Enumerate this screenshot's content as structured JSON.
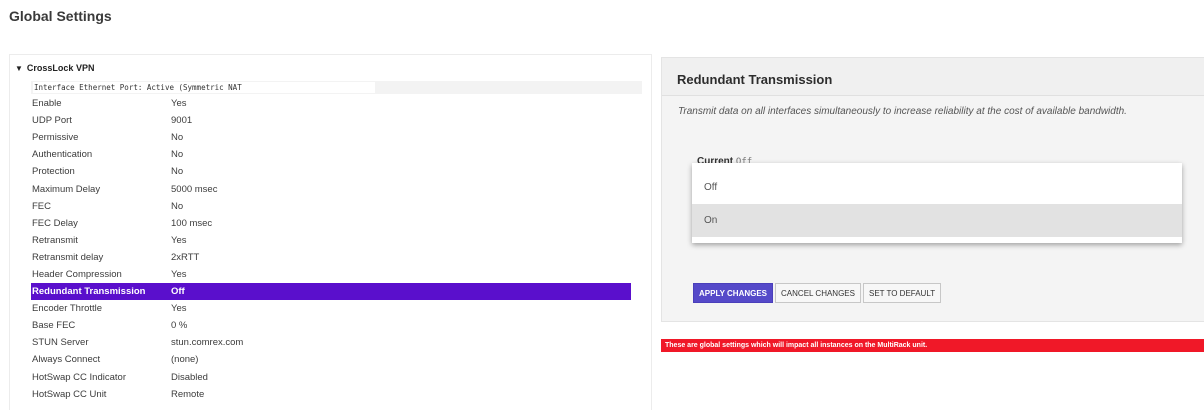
{
  "page": {
    "title": "Global Settings"
  },
  "tree": {
    "group_label": "CrossLock VPN",
    "interface_text": "Interface Ethernet Port: Active (Symmetric NAT",
    "rows": [
      {
        "label": "Enable",
        "value": "Yes"
      },
      {
        "label": "UDP Port",
        "value": "9001"
      },
      {
        "label": "Permissive",
        "value": "No"
      },
      {
        "label": "Authentication",
        "value": "No"
      },
      {
        "label": "Protection",
        "value": "No"
      },
      {
        "label": "Maximum Delay",
        "value": "5000 msec"
      },
      {
        "label": "FEC",
        "value": "No"
      },
      {
        "label": "FEC Delay",
        "value": "100 msec"
      },
      {
        "label": "Retransmit",
        "value": "Yes"
      },
      {
        "label": "Retransmit delay",
        "value": "2xRTT"
      },
      {
        "label": "Header Compression",
        "value": "Yes"
      },
      {
        "label": "Redundant Transmission",
        "value": "Off"
      },
      {
        "label": "Encoder Throttle",
        "value": "Yes"
      },
      {
        "label": "Base FEC",
        "value": "0 %"
      },
      {
        "label": "STUN Server",
        "value": "stun.comrex.com"
      },
      {
        "label": "Always Connect",
        "value": "(none)"
      },
      {
        "label": "HotSwap CC Indicator",
        "value": "Disabled"
      },
      {
        "label": "HotSwap CC Unit",
        "value": "Remote"
      }
    ],
    "selected_index": 11,
    "selected_color": "#5a0fcc"
  },
  "detail": {
    "title": "Redundant Transmission",
    "description": "Transmit data on all interfaces simultaneously to increase reliability at the cost of available bandwidth.",
    "current_label": "Current",
    "current_value": "Off",
    "options": [
      "Off",
      "On"
    ],
    "highlighted_option": "On",
    "buttons": {
      "apply": "APPLY CHANGES",
      "cancel": "CANCEL CHANGES",
      "default": "SET TO DEFAULT"
    },
    "accent_color": "#5549c9"
  },
  "warning": {
    "text": "These are global settings which will impact all instances on the MultiRack unit.",
    "color": "#f01828"
  }
}
